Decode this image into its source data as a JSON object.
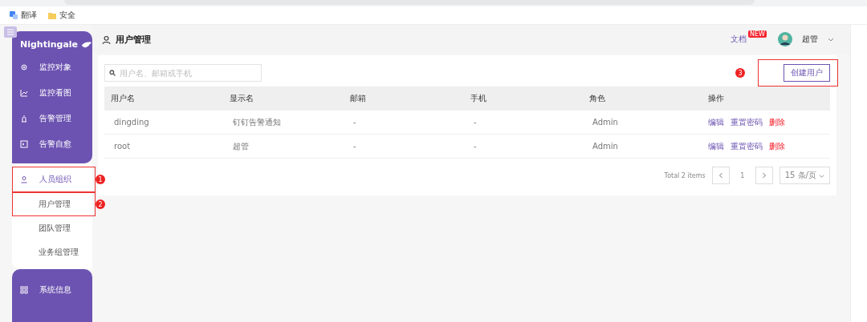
{
  "bookmarks": [
    {
      "label": "翻译",
      "kind": "translate"
    },
    {
      "label": "安全",
      "kind": "folder"
    }
  ],
  "sidebar": {
    "logo": "Nightingale",
    "items": [
      {
        "label": "监控对象",
        "kind": "target"
      },
      {
        "label": "监控看图",
        "kind": "chart"
      },
      {
        "label": "告警管理",
        "kind": "alarm"
      },
      {
        "label": "告警自愈",
        "kind": "terminal"
      },
      {
        "label": "人员组织",
        "kind": "user",
        "expanded": true,
        "marker": "1",
        "children": [
          {
            "label": "用户管理",
            "marker": "2"
          },
          {
            "label": "团队管理"
          },
          {
            "label": "业务组管理"
          }
        ]
      },
      {
        "label": "系统信息",
        "kind": "grid"
      }
    ]
  },
  "header": {
    "title": "用户管理",
    "docs": "文档",
    "docs_badge": "NEW",
    "user": "超管"
  },
  "search": {
    "placeholder": "用户名、邮箱或手机"
  },
  "create_button": {
    "label": "创建用户",
    "marker": "3"
  },
  "table": {
    "columns": [
      "用户名",
      "显示名",
      "邮箱",
      "手机",
      "角色",
      "操作"
    ],
    "rows": [
      {
        "cells": [
          "dingding",
          "钉钉告警通知",
          "-",
          "-",
          "Admin"
        ],
        "actions": [
          {
            "label": "编辑",
            "kind": "normal"
          },
          {
            "label": "重置密码",
            "kind": "normal"
          },
          {
            "label": "删除",
            "kind": "danger"
          }
        ]
      },
      {
        "cells": [
          "root",
          "超管",
          "-",
          "-",
          "Admin"
        ],
        "actions": [
          {
            "label": "编辑",
            "kind": "normal"
          },
          {
            "label": "重置密码",
            "kind": "normal"
          },
          {
            "label": "删除",
            "kind": "danger"
          }
        ]
      }
    ]
  },
  "pagination": {
    "total": "Total 2 items",
    "page": "1",
    "page_size": "15 条/页"
  }
}
